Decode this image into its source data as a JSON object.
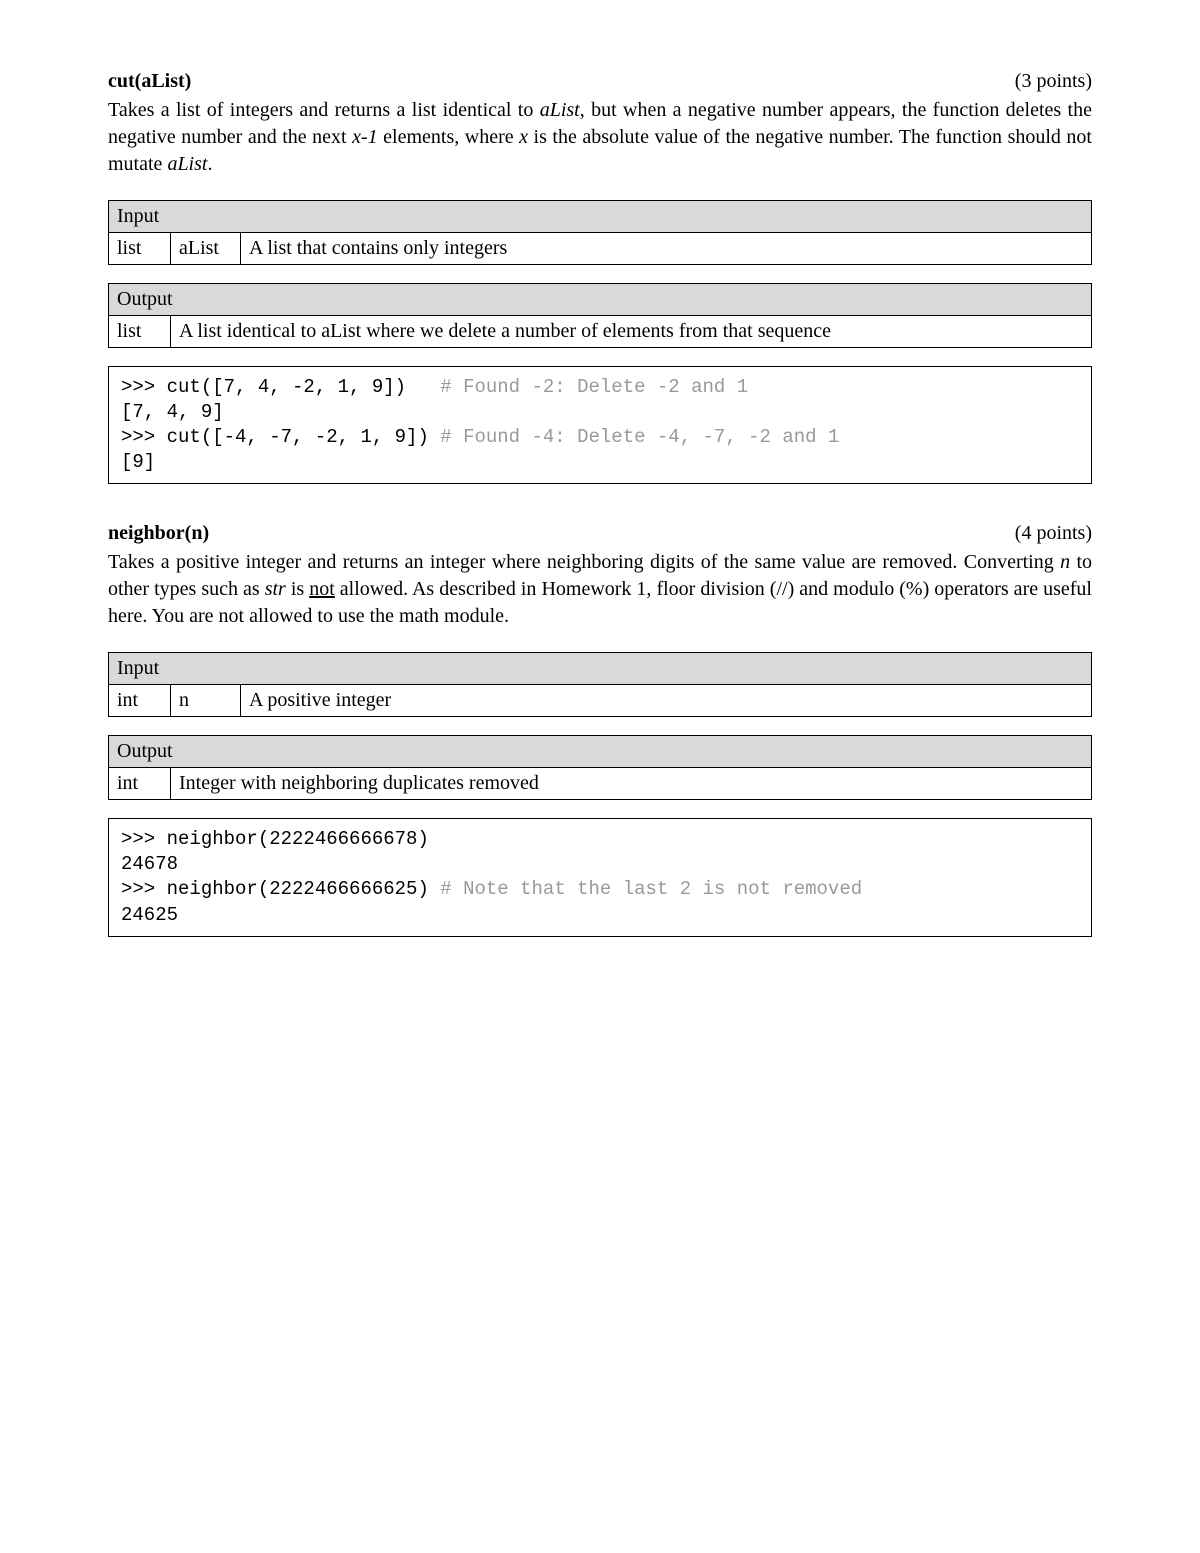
{
  "cut": {
    "name": "cut(aList)",
    "points": "(3 points)",
    "desc_parts": {
      "p1": "Takes a list of integers and returns a list identical to ",
      "aList1": "aList",
      "p2": ", but when a negative number appears, the function deletes the negative number and the next ",
      "x1": "x-1",
      "p3": " elements, where ",
      "x2": "x",
      "p4": " is the absolute value of the negative number. The function should not mutate ",
      "aList2": "aList",
      "p5": "."
    },
    "input": {
      "header": "Input",
      "type": "list",
      "name": "aList",
      "desc": "A list that contains only integers"
    },
    "output": {
      "header": "Output",
      "type": "list",
      "desc": "A list identical to aList where we delete a number of elements from that sequence"
    },
    "code": {
      "l1a": ">>> cut([7, 4, -2, 1, 9])   ",
      "l1c": "# Found -2: Delete -2 and 1",
      "l2": "[7, 4, 9]",
      "l3a": ">>> cut([-4, -7, -2, 1, 9]) ",
      "l3c": "# Found -4: Delete -4, -7, -2 and 1",
      "l4": "[9]"
    }
  },
  "neighbor": {
    "name": "neighbor(n)",
    "points": "(4 points)",
    "desc_parts": {
      "p1": "Takes a positive integer and returns an integer where neighboring digits of the same value are removed. Converting ",
      "n1": "n",
      "p2": " to other types such as ",
      "str1": "str",
      "p3": " is ",
      "not": "not",
      "p4": " allowed. As described in Homework 1, floor division (//) and modulo (%) operators are useful here. You are not allowed to use the math module."
    },
    "input": {
      "header": "Input",
      "type": "int",
      "name": "n",
      "desc": "A positive integer"
    },
    "output": {
      "header": "Output",
      "type": "int",
      "desc": "Integer with neighboring duplicates removed"
    },
    "code": {
      "l1": ">>> neighbor(2222466666678)",
      "l2": "24678",
      "l3a": ">>> neighbor(2222466666625) ",
      "l3c": "# Note that the last 2 is not removed",
      "l4": "24625"
    }
  }
}
